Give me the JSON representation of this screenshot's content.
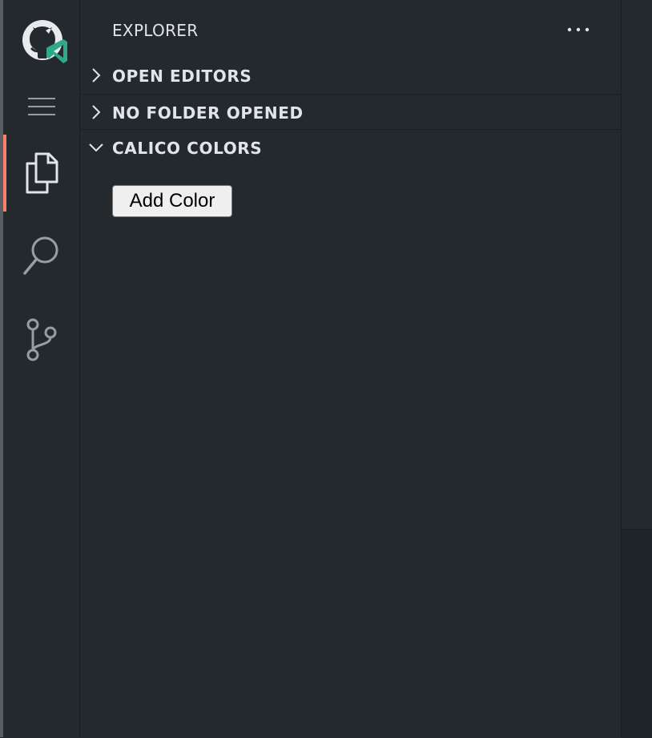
{
  "sidebar": {
    "title": "EXPLORER",
    "sections": [
      {
        "label": "OPEN EDITORS",
        "expanded": false
      },
      {
        "label": "NO FOLDER OPENED",
        "expanded": false
      },
      {
        "label": "CALICO COLORS",
        "expanded": true
      }
    ]
  },
  "calico_colors": {
    "add_button_label": "Add Color"
  },
  "activity_bar": {
    "items": [
      {
        "icon": "files-icon",
        "active": true
      },
      {
        "icon": "search-icon",
        "active": false
      },
      {
        "icon": "source-control-icon",
        "active": false
      }
    ]
  },
  "colors": {
    "background": "#24292e",
    "active_indicator": "#f9826c",
    "logo_accent": "#2ea98c",
    "text": "#e1e4e8",
    "icon": "#959da5"
  }
}
